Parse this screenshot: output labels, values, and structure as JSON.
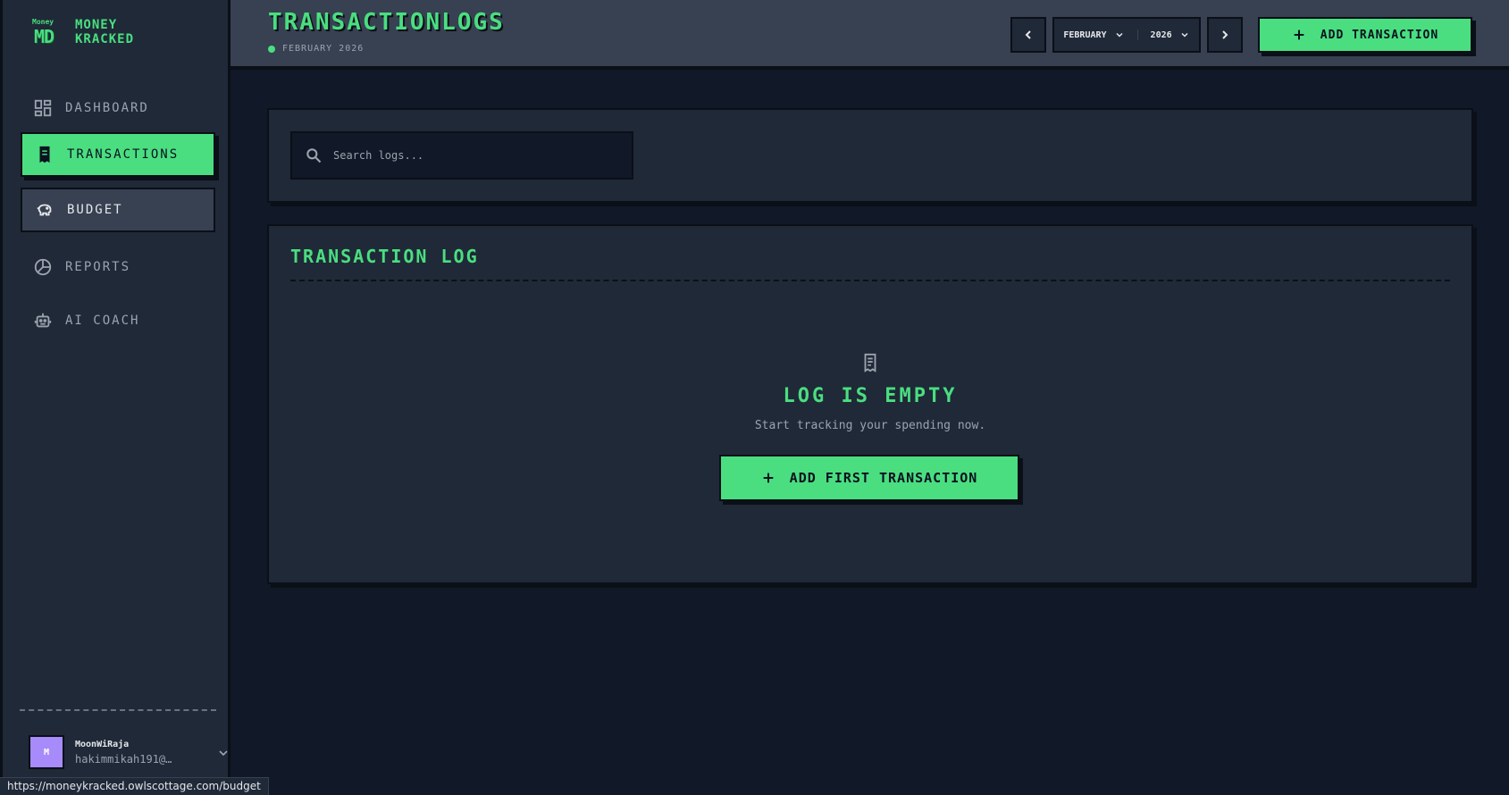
{
  "app": {
    "logo_small": "Money",
    "logo_big": "MD",
    "brand_line1": "MONEY",
    "brand_line2": "KRACKED"
  },
  "sidebar": {
    "items": [
      {
        "label": "DASHBOARD",
        "icon": "grid-icon"
      },
      {
        "label": "TRANSACTIONS",
        "icon": "receipt-icon"
      },
      {
        "label": "BUDGET",
        "icon": "piggy-bank-icon"
      },
      {
        "label": "REPORTS",
        "icon": "pie-chart-icon"
      },
      {
        "label": "AI COACH",
        "icon": "robot-icon"
      }
    ]
  },
  "user": {
    "initial": "M",
    "name": "MoonWiRaja",
    "email": "hakimmikah191@…"
  },
  "status_bar": {
    "url": "https://moneykracked.owlscottage.com/budget"
  },
  "header": {
    "title": "TRANSACTIONLOGS",
    "subtitle": "FEBRUARY 2026",
    "month": "FEBRUARY",
    "year": "2026",
    "add_label": "ADD TRANSACTION"
  },
  "search": {
    "placeholder": "Search logs..."
  },
  "log": {
    "title": "TRANSACTION LOG",
    "empty_title": "LOG IS EMPTY",
    "empty_sub": "Start tracking your spending now.",
    "first_button": "ADD FIRST TRANSACTION"
  },
  "colors": {
    "accent": "#4ade80",
    "background": "#111827",
    "panel": "#1f2937",
    "header": "#374151"
  }
}
